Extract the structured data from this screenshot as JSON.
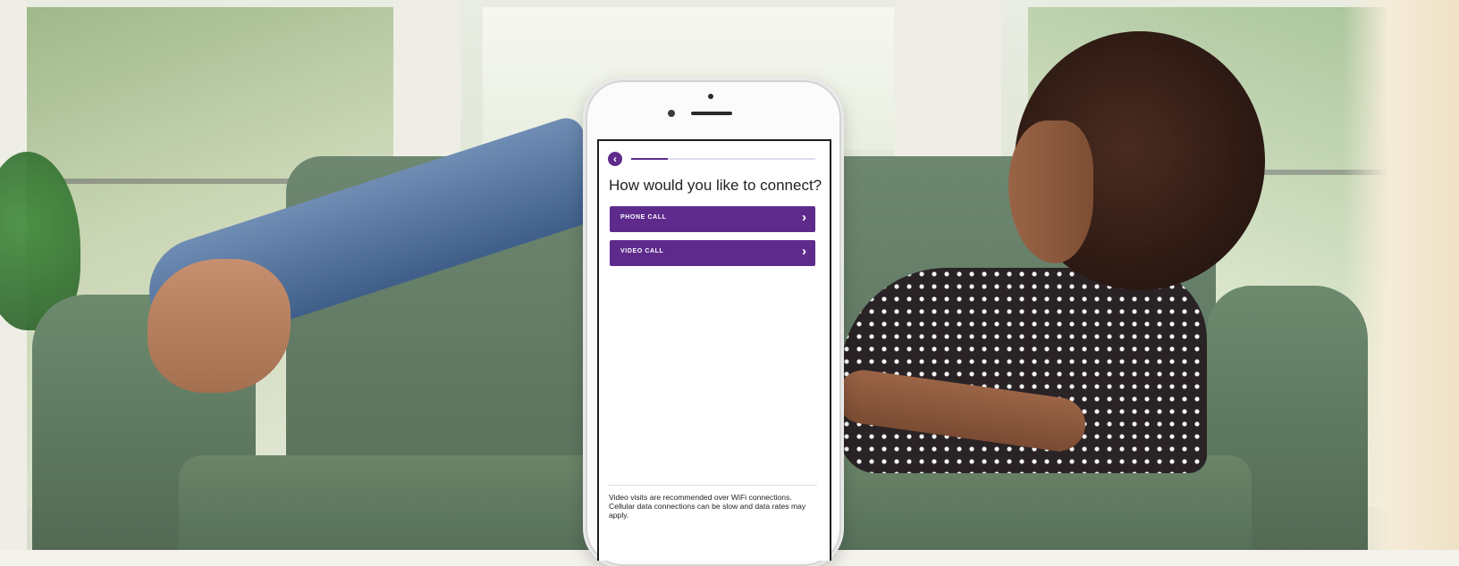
{
  "app": {
    "question": "How would you like to connect?",
    "progress_fraction": 0.2,
    "accent_color": "#5e2b8c",
    "back_icon": "chevron-left-icon",
    "options": [
      {
        "label": "PHONE CALL",
        "icon": "chevron-right-icon"
      },
      {
        "label": "VIDEO CALL",
        "icon": "chevron-right-icon"
      }
    ],
    "footer_note": "Video visits are recommended over WiFi connections. Cellular data connections can be slow and data rates may apply."
  }
}
